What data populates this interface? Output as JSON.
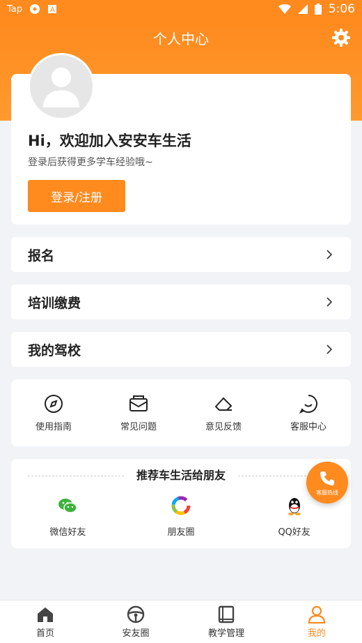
{
  "status_bar": {
    "app_label": "Tap",
    "time": "5:06"
  },
  "header": {
    "title": "个人中心"
  },
  "profile": {
    "welcome": "Hi，欢迎加入安安车生活",
    "subtitle": "登录后获得更多学车经验哦~",
    "login_label": "登录/注册"
  },
  "menu": [
    {
      "label": "报名"
    },
    {
      "label": "培训缴费"
    },
    {
      "label": "我的驾校"
    }
  ],
  "services": [
    {
      "label": "使用指南",
      "icon": "compass-icon"
    },
    {
      "label": "常见问题",
      "icon": "mail-icon"
    },
    {
      "label": "意见反馈",
      "icon": "eraser-icon"
    },
    {
      "label": "客服中心",
      "icon": "chat-icon"
    }
  ],
  "share": {
    "title": "推荐车生活给朋友",
    "items": [
      {
        "label": "微信好友",
        "icon": "wechat-icon"
      },
      {
        "label": "朋友圈",
        "icon": "moments-icon"
      },
      {
        "label": "QQ好友",
        "icon": "qq-icon"
      }
    ]
  },
  "hotline": {
    "label": "客服热线"
  },
  "tabs": [
    {
      "label": "首页",
      "icon": "home-icon"
    },
    {
      "label": "安友圈",
      "icon": "steering-wheel-icon"
    },
    {
      "label": "教学管理",
      "icon": "book-icon"
    },
    {
      "label": "我的",
      "icon": "user-icon",
      "active": true
    }
  ],
  "colors": {
    "accent": "#ff8a1e",
    "background": "#f2f3f7"
  }
}
